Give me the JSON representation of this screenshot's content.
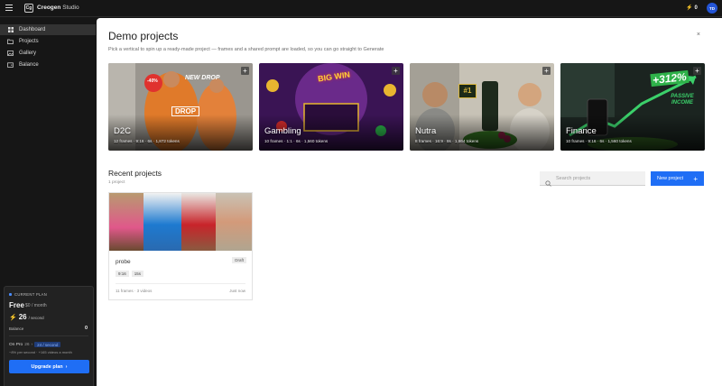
{
  "topbar": {
    "logo_glyph": "Cg",
    "brand_bold": "Creogen",
    "brand_light": "Studio",
    "credits": "0",
    "avatar_initials": "TD"
  },
  "sidebar": {
    "items": [
      {
        "label": "Dashboard",
        "icon": "grid-icon",
        "active": true
      },
      {
        "label": "Projects",
        "icon": "folder-icon",
        "active": false
      },
      {
        "label": "Gallery",
        "icon": "image-icon",
        "active": false
      },
      {
        "label": "Balance",
        "icon": "wallet-icon",
        "active": false
      }
    ],
    "plan": {
      "current_label": "CURRENT PLAN",
      "name": "Free",
      "price": "$0 / month",
      "rate_value": "26",
      "rate_unit": "/ second",
      "balance_label": "Balance",
      "balance_value": "0",
      "on_pro_label": "On Pro",
      "on_pro_from": "26",
      "on_pro_badge": "24 / second",
      "pro_note": "−8% per second · +165 videos a month",
      "upgrade_label": "Upgrade plan"
    }
  },
  "main": {
    "title": "Demo projects",
    "subtitle": "Pick a vertical to spin up a ready-made project — frames and a shared prompt are loaded, so you can go straight to Generate",
    "close_glyph": "×",
    "demo_cards": [
      {
        "name": "D2C",
        "meta": "12 frames · 9:16 · 6s · 1,872 tokens",
        "overlay_text": "NEW DROP",
        "overlay_text_2": "DROP",
        "badge": "-40%"
      },
      {
        "name": "Gambling",
        "meta": "10 frames · 1:1 · 6s · 1,560 tokens",
        "overlay_text": "BIG WIN"
      },
      {
        "name": "Nutra",
        "meta": "8 frames · 16:9 · 8s · 1,664 tokens",
        "overlay_text": "#1"
      },
      {
        "name": "Finance",
        "meta": "10 frames · 9:16 · 6s · 1,560 tokens",
        "overlay_text": "+312%",
        "overlay_text_2": "PASSIVE INCOME"
      }
    ],
    "recent": {
      "title": "Recent projects",
      "count": "1 project",
      "search_placeholder": "Search projects",
      "new_button": "New project",
      "projects": [
        {
          "name": "probe",
          "status": "Draft",
          "tags": [
            "9:16",
            "15s"
          ],
          "meta": "11 frames · 3 videos",
          "time": "Just now"
        }
      ]
    }
  },
  "colors": {
    "accent": "#1f6ef5",
    "sidebar_bg": "#161616",
    "main_bg": "#ffffff"
  }
}
